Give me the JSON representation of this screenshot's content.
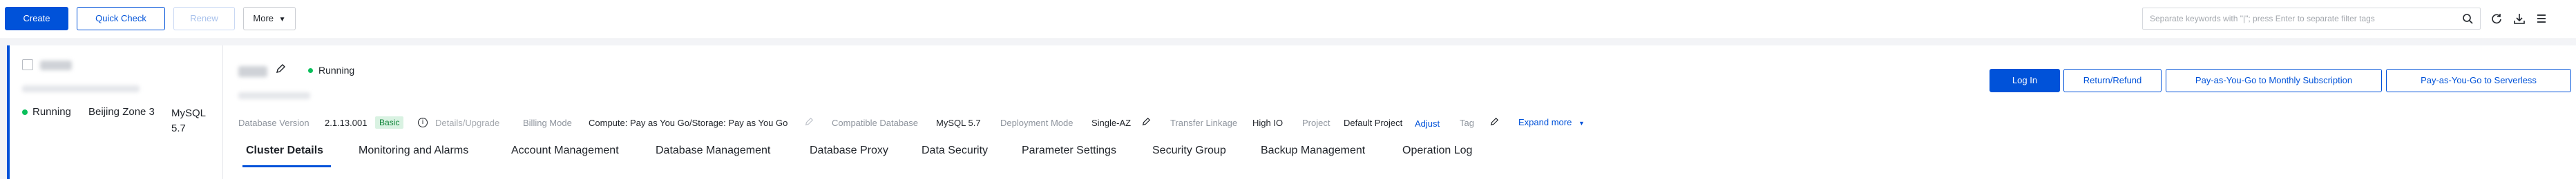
{
  "toolbar": {
    "create_label": "Create",
    "quick_check_label": "Quick Check",
    "renew_label": "Renew",
    "more_label": "More",
    "search_placeholder": "Separate keywords with \"|\"; press Enter to separate filter tags"
  },
  "instance_card": {
    "status": "Running",
    "zone": "Beijing Zone 3",
    "engine": "MySQL 5.7"
  },
  "detail": {
    "status": "Running",
    "database_version_label": "Database Version",
    "database_version_value": "2.1.13.001",
    "basic_tag": "Basic",
    "details_upgrade": "Details/Upgrade",
    "billing_mode_label": "Billing Mode",
    "billing_mode_value": "Compute: Pay as You Go/Storage: Pay as You Go",
    "compatible_db_label": "Compatible Database",
    "compatible_db_value": "MySQL 5.7",
    "deployment_mode_label": "Deployment Mode",
    "deployment_mode_value": "Single-AZ",
    "transfer_linkage_label": "Transfer Linkage",
    "transfer_linkage_value": "High IO",
    "project_label": "Project",
    "project_value": "Default Project",
    "adjust_label": "Adjust",
    "tag_label": "Tag",
    "expand_more": "Expand more"
  },
  "actions": {
    "log_in": "Log In",
    "return_refund": "Return/Refund",
    "to_monthly": "Pay-as-You-Go to Monthly Subscription",
    "to_serverless": "Pay-as-You-Go to Serverless"
  },
  "tabs": [
    "Cluster Details",
    "Monitoring and Alarms",
    "Account Management",
    "Database Management",
    "Database Proxy",
    "Data Security",
    "Parameter Settings",
    "Security Group",
    "Backup Management",
    "Operation Log"
  ],
  "colors": {
    "primary": "#0052d9",
    "running": "#0abf5b",
    "basic_tag_bg": "#d9f2e2"
  }
}
